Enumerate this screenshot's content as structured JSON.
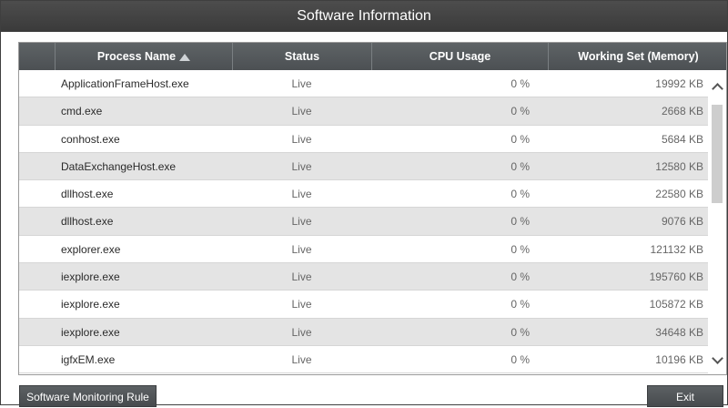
{
  "window": {
    "title": "Software Information"
  },
  "table": {
    "headers": [
      "",
      "Process Name",
      "Status",
      "CPU Usage",
      "Working Set (Memory)"
    ],
    "sort_column": "Process Name",
    "sort_direction": "ascending",
    "rows": [
      {
        "name": "ApplicationFrameHost.exe",
        "status": "Live",
        "cpu": "0 %",
        "memory": "19992 KB"
      },
      {
        "name": "cmd.exe",
        "status": "Live",
        "cpu": "0 %",
        "memory": "2668 KB"
      },
      {
        "name": "conhost.exe",
        "status": "Live",
        "cpu": "0 %",
        "memory": "5684 KB"
      },
      {
        "name": "DataExchangeHost.exe",
        "status": "Live",
        "cpu": "0 %",
        "memory": "12580 KB"
      },
      {
        "name": "dllhost.exe",
        "status": "Live",
        "cpu": "0 %",
        "memory": "22580 KB"
      },
      {
        "name": "dllhost.exe",
        "status": "Live",
        "cpu": "0 %",
        "memory": "9076 KB"
      },
      {
        "name": "explorer.exe",
        "status": "Live",
        "cpu": "0 %",
        "memory": "121132 KB"
      },
      {
        "name": "iexplore.exe",
        "status": "Live",
        "cpu": "0 %",
        "memory": "195760 KB"
      },
      {
        "name": "iexplore.exe",
        "status": "Live",
        "cpu": "0 %",
        "memory": "105872 KB"
      },
      {
        "name": "iexplore.exe",
        "status": "Live",
        "cpu": "0 %",
        "memory": "34648 KB"
      },
      {
        "name": "igfxEM.exe",
        "status": "Live",
        "cpu": "0 %",
        "memory": "10196 KB"
      }
    ]
  },
  "scrollbar": {
    "up_icon": "chevron-up-icon",
    "down_icon": "chevron-down-icon"
  },
  "buttons": {
    "monitoring_rule": "Software Monitoring Rule",
    "exit": "Exit"
  },
  "colors": {
    "titlebar": "#3f3f3f",
    "header": "#55595c",
    "row_alt": "#e4e4e4",
    "button": "#505457"
  }
}
